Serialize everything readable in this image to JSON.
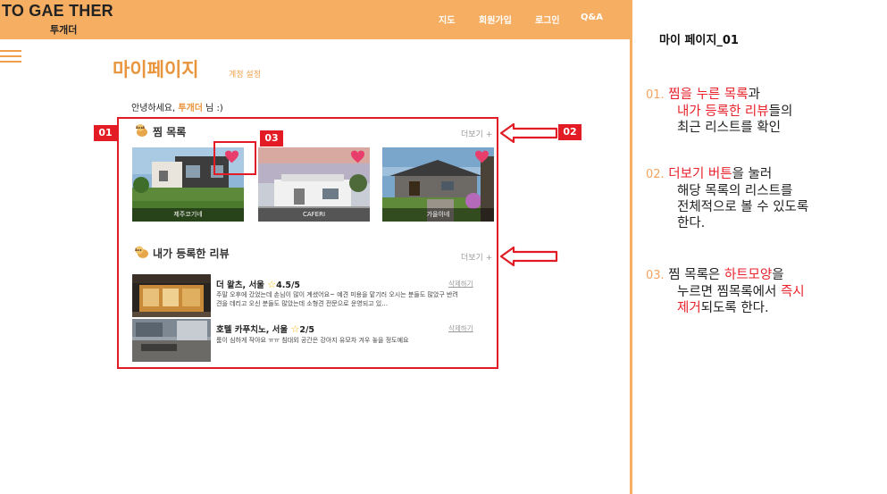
{
  "header": {
    "logo_en": "TO GAE THER",
    "logo_ko": "투개더",
    "nav": [
      "지도",
      "회원가입",
      "로그인",
      "Q&A"
    ]
  },
  "page": {
    "title": "마이페이지",
    "account_settings": "계정 설정",
    "greeting_prefix": "안녕하세요, ",
    "greeting_name": "투개더",
    "greeting_suffix": " 님 :)"
  },
  "wishlist": {
    "title": "찜 목록",
    "more": "더보기 +",
    "items": [
      {
        "name": "제주코기네"
      },
      {
        "name": "CAFERI"
      },
      {
        "name": "가을이네"
      }
    ]
  },
  "reviews": {
    "title": "내가 등록한 리뷰",
    "more": "더보기 +",
    "items": [
      {
        "place": "더 왈츠, 서울",
        "rating": "4.5/5",
        "text": "주말 오후에 갔었는데 손님이 많이 계셨어요~ 예견 미용을 맡기러 오시는 분들도 많았구 반려견을 데리고 오신 분들도 많았는데 소형견 전문으로 운영되고 있...",
        "delete": "삭제하기"
      },
      {
        "place": "호텔 카푸치노, 서울",
        "rating": "2/5",
        "text": "룸이 심하게 작아요 ㅠㅠ 침대외 공간은 강아지 유모차 겨우 놓을 정도예요",
        "delete": "삭제하기"
      }
    ]
  },
  "labels": [
    "01",
    "02",
    "03"
  ],
  "panel": {
    "title": "마이 페이지_01",
    "notes": [
      {
        "num": "01.",
        "l1_hl": "찜을 누른 목록",
        "l1_rest": "과",
        "l2_hl": "내가 등록한 리뷰",
        "l2_rest": "들의",
        "l3": "최근 리스트를 확인"
      },
      {
        "num": "02.",
        "l1_hl": "더보기 버튼",
        "l1_rest": "을 눌러",
        "l2": "해당 목록의 리스트를",
        "l3": "전체적으로 볼 수 있도록",
        "l4": "한다."
      },
      {
        "num": "03.",
        "l1_pre": "찜 목록은 ",
        "l1_hl": "하트모양",
        "l1_rest": "을",
        "l2_pre": "누르면 찜목록에서 ",
        "l2_hl": "즉시",
        "l3_hl": "제거",
        "l3_rest": "되도록 한다."
      }
    ]
  },
  "colors": {
    "brand_orange": "#f6ae62",
    "title_orange": "#e8953d",
    "annotation_red": "#e21b24",
    "heart_pink": "#e83e6c"
  }
}
